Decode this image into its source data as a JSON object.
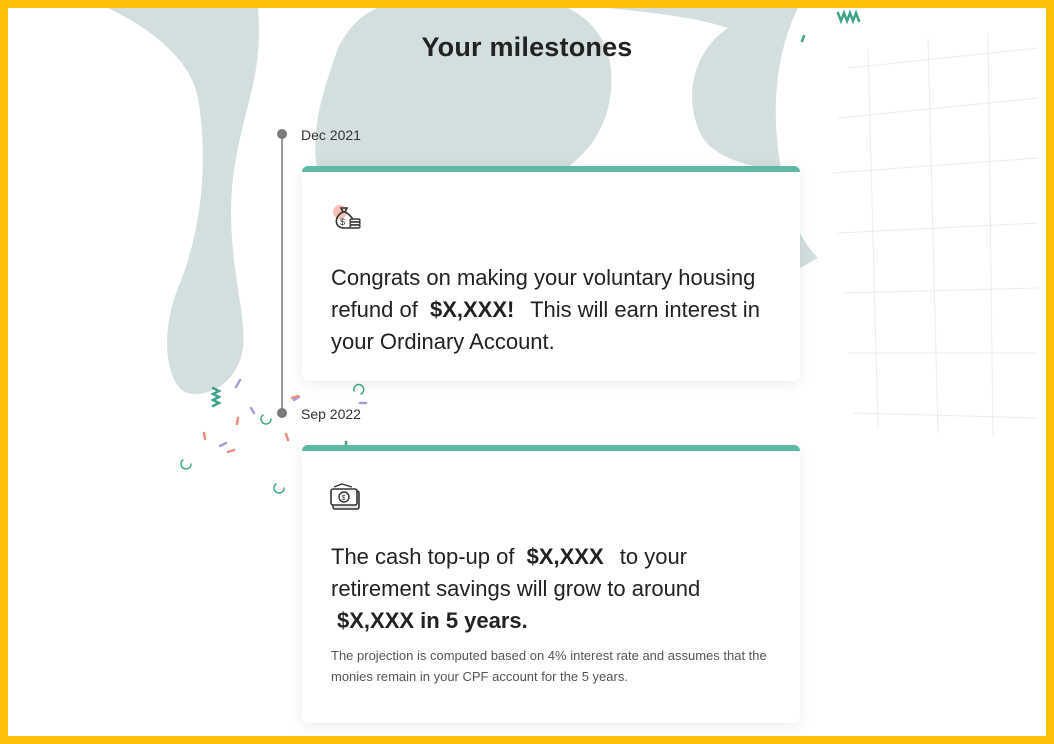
{
  "page": {
    "title": "Your milestones"
  },
  "colors": {
    "border": "#FFC107",
    "accent": "#5DB8A6",
    "blob": "#D3DFDE"
  },
  "milestones": [
    {
      "date": "Dec 2021",
      "icon": "money-bag-icon",
      "text_before": "Congrats on making your voluntary housing refund of",
      "amount": "$X,XXX!",
      "text_after": "This will earn interest in your Ordinary Account."
    },
    {
      "date": "Sep 2022",
      "icon": "cash-wallet-icon",
      "text_before": "The cash top-up of",
      "amount": "$X,XXX",
      "text_middle": "to your retirement savings will grow to around",
      "projection": "$X,XXX in 5 years.",
      "footnote": "The projection is computed based on 4% interest rate and assumes that the monies remain in your CPF account for the 5 years."
    }
  ]
}
